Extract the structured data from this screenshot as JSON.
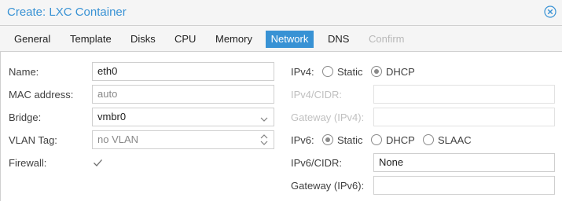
{
  "window": {
    "title": "Create: LXC Container",
    "close_icon": "close-circle-icon"
  },
  "tabs": [
    {
      "label": "General",
      "state": "normal"
    },
    {
      "label": "Template",
      "state": "normal"
    },
    {
      "label": "Disks",
      "state": "normal"
    },
    {
      "label": "CPU",
      "state": "normal"
    },
    {
      "label": "Memory",
      "state": "normal"
    },
    {
      "label": "Network",
      "state": "active"
    },
    {
      "label": "DNS",
      "state": "normal"
    },
    {
      "label": "Confirm",
      "state": "disabled"
    }
  ],
  "colors": {
    "accent": "#3892d4",
    "panel_bg": "#ffffff",
    "chrome_bg": "#f5f5f5",
    "disabled_text": "#c0c0c0"
  },
  "form": {
    "name": {
      "label": "Name:",
      "value": "eth0"
    },
    "mac": {
      "label": "MAC address:",
      "value": "auto"
    },
    "bridge": {
      "label": "Bridge:",
      "value": "vmbr0",
      "icon": "chevron-down-icon"
    },
    "vlan": {
      "label": "VLAN Tag:",
      "value": "no VLAN",
      "icon": "spinner-updown-icon"
    },
    "firewall": {
      "label": "Firewall:",
      "checked": true,
      "icon": "checkmark-icon"
    },
    "ipv4": {
      "label": "IPv4:",
      "options": [
        {
          "label": "Static",
          "selected": false
        },
        {
          "label": "DHCP",
          "selected": true
        }
      ]
    },
    "ipv4_cidr": {
      "label": "IPv4/CIDR:",
      "value": "",
      "disabled": true
    },
    "gateway4": {
      "label": "Gateway (IPv4):",
      "value": "",
      "disabled": true
    },
    "ipv6": {
      "label": "IPv6:",
      "options": [
        {
          "label": "Static",
          "selected": true
        },
        {
          "label": "DHCP",
          "selected": false
        },
        {
          "label": "SLAAC",
          "selected": false
        }
      ]
    },
    "ipv6_cidr": {
      "label": "IPv6/CIDR:",
      "value": "None"
    },
    "gateway6": {
      "label": "Gateway (IPv6):",
      "value": ""
    }
  }
}
